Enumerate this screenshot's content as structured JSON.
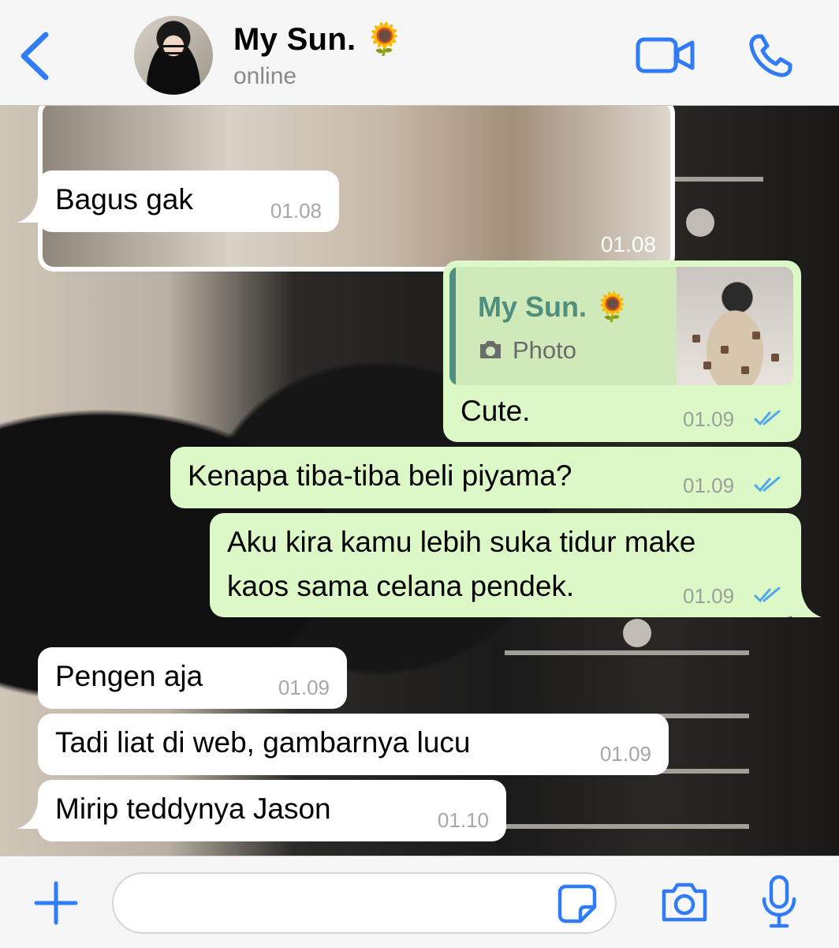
{
  "header": {
    "contact_name": "My Sun. 🌻",
    "status": "online",
    "back_icon": "chevron-left-icon",
    "video_icon": "video-camera-icon",
    "call_icon": "phone-icon"
  },
  "messages": [
    {
      "direction": "incoming",
      "type": "image",
      "time": "01.08"
    },
    {
      "direction": "incoming",
      "text": "Bagus gak",
      "time": "01.08"
    },
    {
      "direction": "outgoing",
      "reply_to": {
        "name": "My Sun. 🌻",
        "label": "Photo"
      },
      "text": "Cute.",
      "time": "01.09",
      "read": true
    },
    {
      "direction": "outgoing",
      "text": "Kenapa tiba-tiba beli piyama?",
      "time": "01.09",
      "read": true
    },
    {
      "direction": "outgoing",
      "lines": [
        "Aku kira kamu lebih suka tidur make",
        "kaos sama celana pendek."
      ],
      "time": "01.09",
      "read": true
    },
    {
      "direction": "incoming",
      "text": "Pengen aja",
      "time": "01.09"
    },
    {
      "direction": "incoming",
      "text": "Tadi liat di web, gambarnya lucu",
      "time": "01.09"
    },
    {
      "direction": "incoming",
      "text": "Mirip teddynya Jason",
      "time": "01.10"
    }
  ],
  "input_bar": {
    "plus_icon": "plus-icon",
    "sticker_icon": "sticker-icon",
    "camera_icon": "camera-icon",
    "mic_icon": "microphone-icon",
    "placeholder": ""
  },
  "colors": {
    "accent": "#2f7cf6",
    "outgoing_bubble": "#dcf8c6",
    "incoming_bubble": "#ffffff",
    "quote_name": "#4f8f80",
    "read_tick": "#4fa8ea"
  }
}
